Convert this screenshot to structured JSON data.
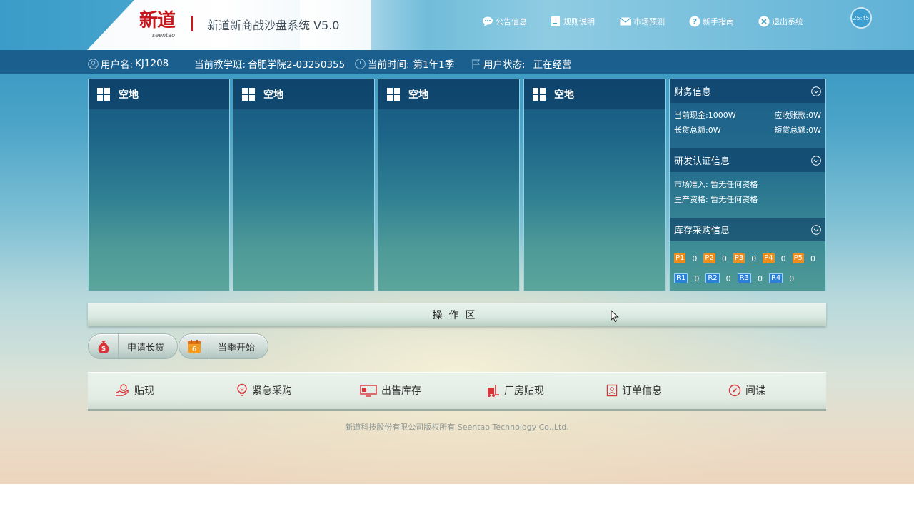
{
  "header": {
    "logo_cn": "新道",
    "logo_en": "seentao",
    "title": "新道新商战沙盘系统 V5.0",
    "nav": [
      {
        "label": "公告信息",
        "icon": "chat-bubble-icon"
      },
      {
        "label": "规则说明",
        "icon": "document-icon"
      },
      {
        "label": "市场预测",
        "icon": "mail-icon"
      },
      {
        "label": "新手指南",
        "icon": "question-icon"
      },
      {
        "label": "退出系统",
        "icon": "close-circle-icon"
      }
    ],
    "clock": "25:45"
  },
  "infobar": {
    "username_label": "用户名:",
    "username": "KJ1208",
    "class_label": "当前教学班:",
    "class_value": "合肥学院2-03250355",
    "time_label": "当前时间:",
    "time_value": "第1年1季",
    "status_label": "用户状态:",
    "status_value": "正在经营"
  },
  "plots": [
    {
      "label": "空地"
    },
    {
      "label": "空地"
    },
    {
      "label": "空地"
    },
    {
      "label": "空地"
    }
  ],
  "finance": {
    "title": "财务信息",
    "cash": "当前现金:1000W",
    "receivable": "应收账款:0W",
    "long_loan": "长贷总额:0W",
    "short_loan": "短贷总额:0W"
  },
  "rd": {
    "title": "研发认证信息",
    "market_access": "市场准入: 暂无任何资格",
    "production_qualification": "生产资格: 暂无任何资格"
  },
  "inventory": {
    "title": "库存采购信息",
    "products": [
      {
        "code": "P1",
        "qty": "0"
      },
      {
        "code": "P2",
        "qty": "0"
      },
      {
        "code": "P3",
        "qty": "0"
      },
      {
        "code": "P4",
        "qty": "0"
      },
      {
        "code": "P5",
        "qty": "0"
      }
    ],
    "materials": [
      {
        "code": "R1",
        "qty": "0"
      },
      {
        "code": "R2",
        "qty": "0"
      },
      {
        "code": "R3",
        "qty": "0"
      },
      {
        "code": "R4",
        "qty": "0"
      }
    ]
  },
  "operation": {
    "title": "操作区",
    "buttons": [
      {
        "label": "申请长贷",
        "icon": "money-bag-icon"
      },
      {
        "label": "当季开始",
        "icon": "calendar-icon",
        "icon_text": "6"
      }
    ]
  },
  "actions": [
    {
      "label": "贴现",
      "icon": "hand-coin-icon"
    },
    {
      "label": "紧急采购",
      "icon": "lightbulb-icon"
    },
    {
      "label": "出售库存",
      "icon": "monitor-icon"
    },
    {
      "label": "厂房贴现",
      "icon": "forklift-icon"
    },
    {
      "label": "订单信息",
      "icon": "order-icon"
    },
    {
      "label": "间谍",
      "icon": "compass-icon"
    }
  ],
  "footer": "新道科技股份有限公司版权所有 Seentao Technology Co.,Ltd.",
  "colors": {
    "brand_red": "#c8161d",
    "infobar_bg": "#1b5f8f",
    "product_badge": "#f08c1a",
    "material_badge": "#2a7fd6",
    "action_icon": "#d9333a"
  }
}
